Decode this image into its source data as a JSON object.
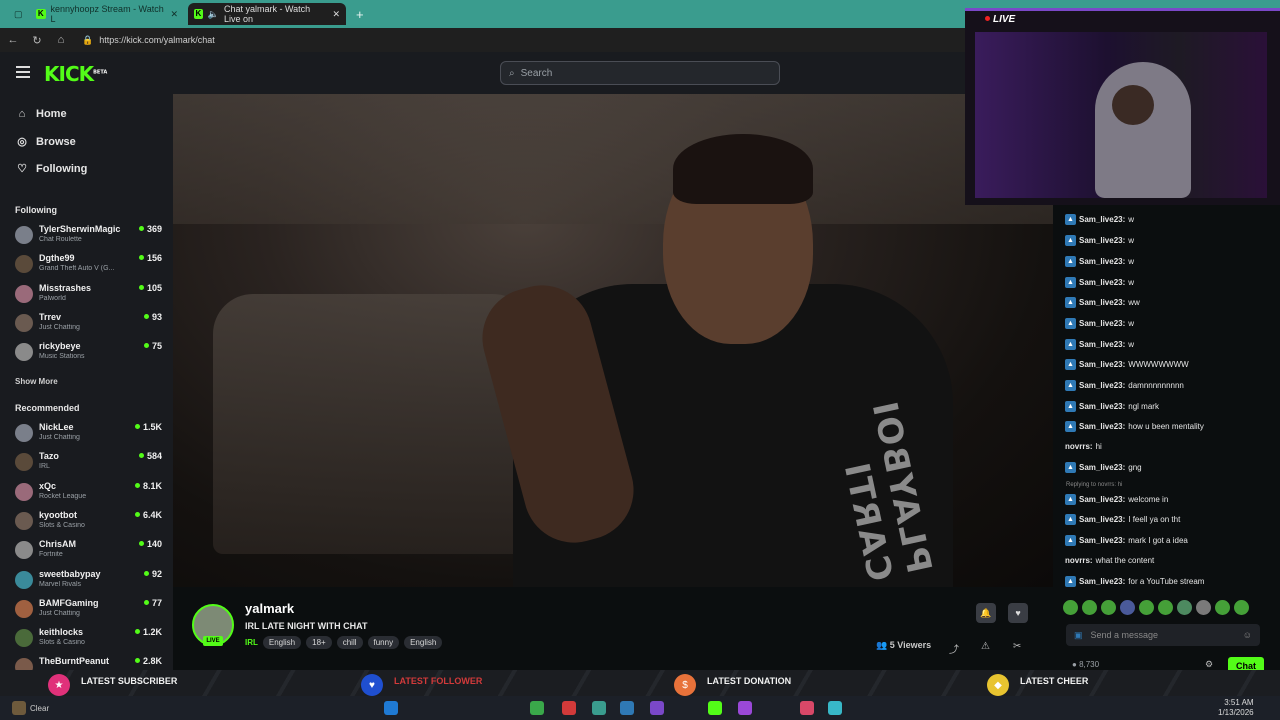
{
  "browser": {
    "tabs": [
      {
        "label": "kennyhoopz Stream - Watch L"
      },
      {
        "label": "Chat yalmark - Watch Live on"
      }
    ],
    "url": "https://kick.com/yalmark/chat"
  },
  "header": {
    "logo": "KICK",
    "logo_beta": "BETA",
    "search_placeholder": "Search"
  },
  "sidebar": {
    "nav": [
      {
        "label": "Home"
      },
      {
        "label": "Browse"
      },
      {
        "label": "Following"
      }
    ],
    "following_heading": "Following",
    "following": [
      {
        "name": "TylerSherwinMagic",
        "category": "Chat Roulette",
        "viewers": "369"
      },
      {
        "name": "Dgthe99",
        "category": "Grand Theft Auto V (G...",
        "viewers": "156"
      },
      {
        "name": "Misstrashes",
        "category": "Palworld",
        "viewers": "105"
      },
      {
        "name": "Trrev",
        "category": "Just Chatting",
        "viewers": "93"
      },
      {
        "name": "rickybeye",
        "category": "Music Stations",
        "viewers": "75"
      }
    ],
    "show_more": "Show More",
    "recommended_heading": "Recommended",
    "recommended": [
      {
        "name": "NickLee",
        "category": "Just Chatting",
        "viewers": "1.5K"
      },
      {
        "name": "Tazo",
        "category": "IRL",
        "viewers": "584"
      },
      {
        "name": "xQc",
        "category": "Rocket League",
        "viewers": "8.1K"
      },
      {
        "name": "kyootbot",
        "category": "Slots & Casino",
        "viewers": "6.4K"
      },
      {
        "name": "ChrisAM",
        "category": "Fortnite",
        "viewers": "140"
      },
      {
        "name": "sweetbabypay",
        "category": "Marvel Rivals",
        "viewers": "92"
      },
      {
        "name": "BAMFGaming",
        "category": "Just Chatting",
        "viewers": "77"
      },
      {
        "name": "keithlocks",
        "category": "Slots & Casino",
        "viewers": "1.2K"
      },
      {
        "name": "TheBurntPeanut",
        "category": "",
        "viewers": "2.8K"
      }
    ]
  },
  "video": {
    "shirt_text": "PLAYBOI CARTI"
  },
  "stream": {
    "streamer": "yalmark",
    "live_label": "LIVE",
    "title": "IRL LATE NIGHT WITH CHAT",
    "category": "IRL",
    "tags": [
      "English",
      "18+",
      "chill",
      "funny",
      "English"
    ],
    "viewers": "5 Viewers"
  },
  "chat": {
    "messages": [
      {
        "user": "Sam_live23:",
        "text": "w",
        "badge": true
      },
      {
        "user": "Sam_live23:",
        "text": "w",
        "badge": true
      },
      {
        "user": "Sam_live23:",
        "text": "w",
        "badge": true
      },
      {
        "user": "Sam_live23:",
        "text": "w",
        "badge": true
      },
      {
        "user": "Sam_live23:",
        "text": "ww",
        "badge": true
      },
      {
        "user": "Sam_live23:",
        "text": "w",
        "badge": true
      },
      {
        "user": "Sam_live23:",
        "text": "w",
        "badge": true
      },
      {
        "user": "Sam_live23:",
        "text": "WWWWWWWW",
        "badge": true
      },
      {
        "user": "Sam_live23:",
        "text": "damnnnnnnnnn",
        "badge": true
      },
      {
        "user": "Sam_live23:",
        "text": "ngl mark",
        "badge": true
      },
      {
        "user": "Sam_live23:",
        "text": "how u been mentality",
        "badge": true
      },
      {
        "user": "novrrs:",
        "text": "hi",
        "badge": false
      },
      {
        "user": "Sam_live23:",
        "text": "gng",
        "badge": true
      },
      {
        "user": "Sam_live23:",
        "text": "welcome in",
        "badge": true
      },
      {
        "user": "Sam_live23:",
        "text": "I feell ya on tht",
        "badge": true
      },
      {
        "user": "Sam_live23:",
        "text": "mark I got a idea",
        "badge": true
      },
      {
        "user": "novrrs:",
        "text": "what the content",
        "badge": false
      },
      {
        "user": "Sam_live23:",
        "text": "for a YouTube stream",
        "badge": true
      }
    ],
    "reply_note": "Replying to novrrs: hi",
    "input_placeholder": "Send a message",
    "points": "8,730",
    "send_label": "Chat"
  },
  "webcam": {
    "live_label": "LIVE"
  },
  "ticker": [
    {
      "label": "LATEST SUBSCRIBER"
    },
    {
      "label": "LATEST FOLLOWER"
    },
    {
      "label": "LATEST DONATION"
    },
    {
      "label": "LATEST CHEER"
    }
  ],
  "taskbar": {
    "weather": "Clear",
    "time": "3:51 AM",
    "date": "1/13/2026"
  },
  "colors": {
    "brand": "#53fc18",
    "sidebar_bg": "#191b1f",
    "page_bg": "#0b0e0f",
    "tab_bar": "#3a9c8e",
    "webcam_border": "#7a48c8"
  }
}
